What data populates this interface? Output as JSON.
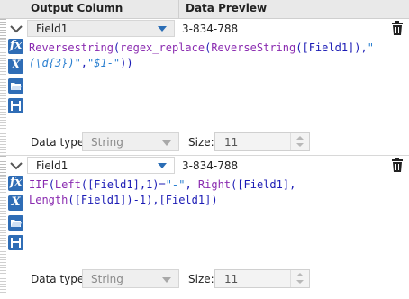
{
  "header": {
    "output_column": "Output Column",
    "data_preview": "Data Preview"
  },
  "rows": [
    {
      "field": "Field1",
      "preview": "3-834-788",
      "expression": {
        "line1": {
          "fn1": "Reversestring",
          "p1": "(",
          "fn2": "regex_replace",
          "p2": "(",
          "fn3": "ReverseString",
          "p3": "(",
          "field": "[Field1]",
          "p4": "),",
          "str1": "\"",
          "str2": "(\\d{3})\"",
          "p5": ",",
          "str3": "\"$1-\"",
          "p6": "))"
        }
      },
      "data_type_label": "Data type:",
      "data_type": "String",
      "size_label": "Size:",
      "size": "11"
    },
    {
      "field": "Field1",
      "preview": "3-834-788",
      "expression": {
        "a_fn": "IIF",
        "a_p": "(",
        "b_fn": "Left",
        "b_p": "(",
        "f1": "[Field1]",
        "c": ",1)=",
        "s1": "\"-\"",
        "d": ", ",
        "r_fn": "Right",
        "r_p": "(",
        "f2": "[Field1]",
        "e": ",",
        "l_fn": "Length",
        "l_p": "(",
        "f3": "[Field1]",
        "g": ")-1),",
        "f4": "[Field1]",
        "h": ")"
      },
      "data_type_label": "Data type:",
      "data_type": "String",
      "size_label": "Size:",
      "size": "11"
    }
  ],
  "icons": [
    "chevron-down-icon",
    "trash-icon",
    "fx-icon",
    "variable-x-icon",
    "folder-open-icon",
    "save-icon"
  ],
  "colors": {
    "icon_blue": "#2f6db6",
    "function_purple": "#8a2bb0",
    "string_blue": "#2a7fd0",
    "field_blue": "#1b1bb5"
  }
}
